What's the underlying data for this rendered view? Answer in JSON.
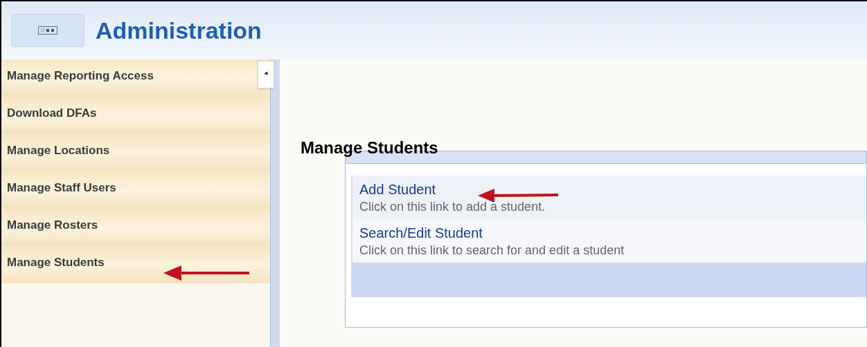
{
  "header": {
    "title": "Administration"
  },
  "sidebar": {
    "collapse_glyph": "◂",
    "items": [
      {
        "label": "Manage Reporting Access"
      },
      {
        "label": "Download DFAs"
      },
      {
        "label": "Manage Locations"
      },
      {
        "label": "Manage Staff Users"
      },
      {
        "label": "Manage Rosters"
      },
      {
        "label": "Manage Students"
      }
    ]
  },
  "main": {
    "heading": "Manage Students",
    "links": [
      {
        "title": "Add Student",
        "description": "Click on this link to add a student."
      },
      {
        "title": "Search/Edit Student",
        "description": "Click on this link to search for and edit a student"
      }
    ]
  }
}
